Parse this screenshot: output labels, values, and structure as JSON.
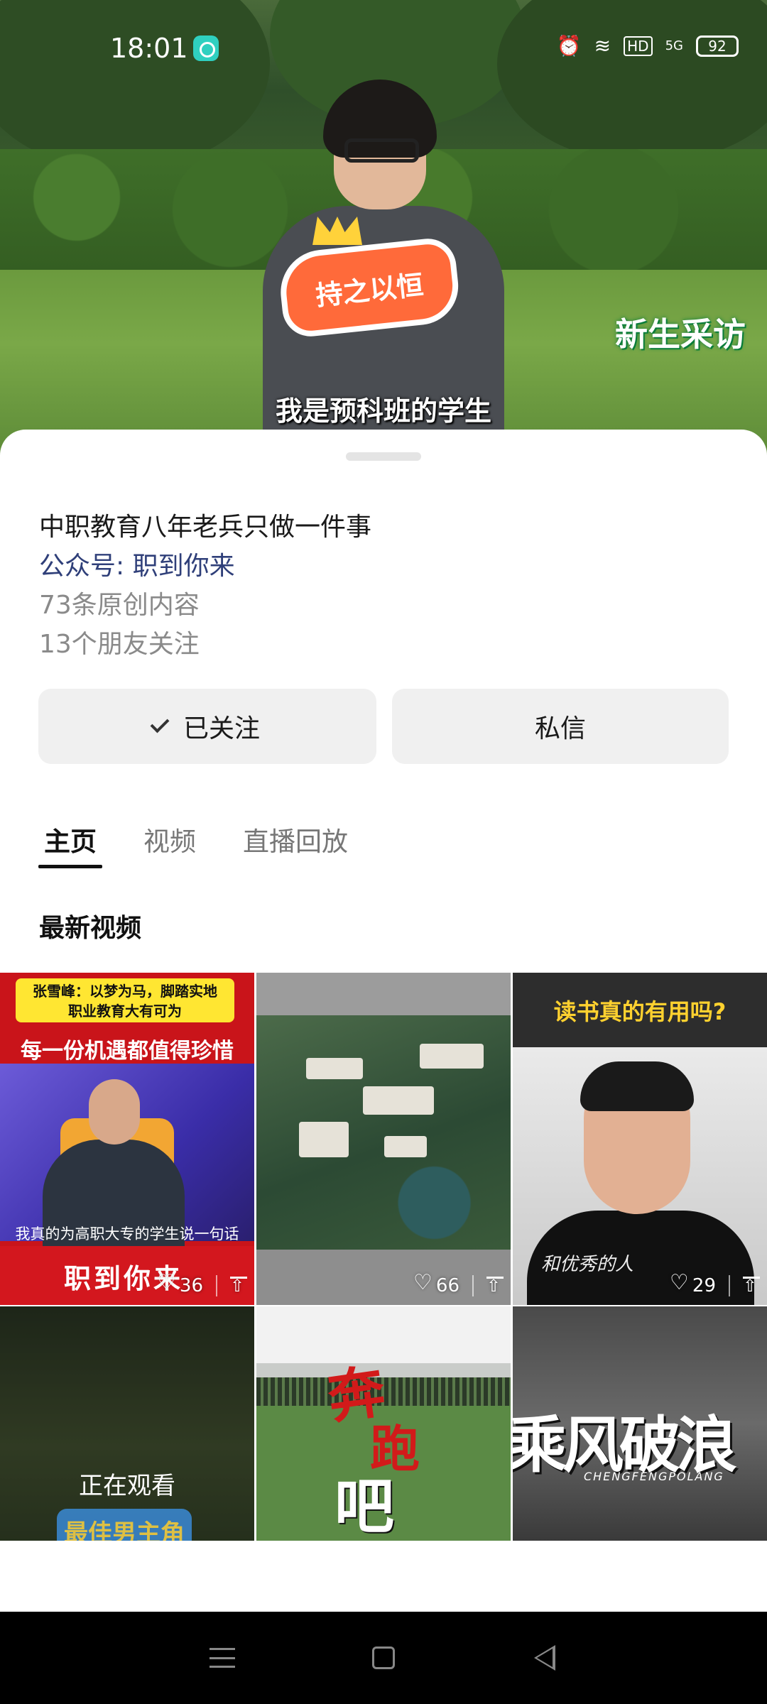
{
  "status_bar": {
    "time": "18:01",
    "battery": "92",
    "network": "5G",
    "hd": "HD"
  },
  "video": {
    "sign_text": "持之以恒",
    "badge_text": "新生采访",
    "subtitle": "我是预科班的学生"
  },
  "profile": {
    "description": "中职教育八年老兵只做一件事",
    "account": "公众号: 职到你来",
    "original_count": "73条原创内容",
    "friends_following": "13个朋友关注"
  },
  "actions": {
    "follow_label": "已关注",
    "message_label": "私信"
  },
  "tabs": [
    {
      "label": "主页",
      "active": true
    },
    {
      "label": "视频",
      "active": false
    },
    {
      "label": "直播回放",
      "active": false
    }
  ],
  "section_title": "最新视频",
  "videos": [
    {
      "banner": "张雪峰：以梦为马，脚踏实地\n职业教育大有可为",
      "headline": "每一份机遇都值得珍惜",
      "caption": "我真的为高职大专的学生说一句话",
      "footer": "职到你来",
      "likes": "36"
    },
    {
      "likes": "66"
    },
    {
      "headline": "读书真的有用吗?",
      "script": "和优秀的人",
      "likes": "29"
    },
    {
      "status": "正在观看",
      "badge": "最佳男主角"
    },
    {
      "title_top": "奔",
      "title_mid": "跑",
      "title_bottom": "吧"
    },
    {
      "title": "乘风破浪",
      "subtitle": "CHENGFENGPOLANG"
    }
  ]
}
